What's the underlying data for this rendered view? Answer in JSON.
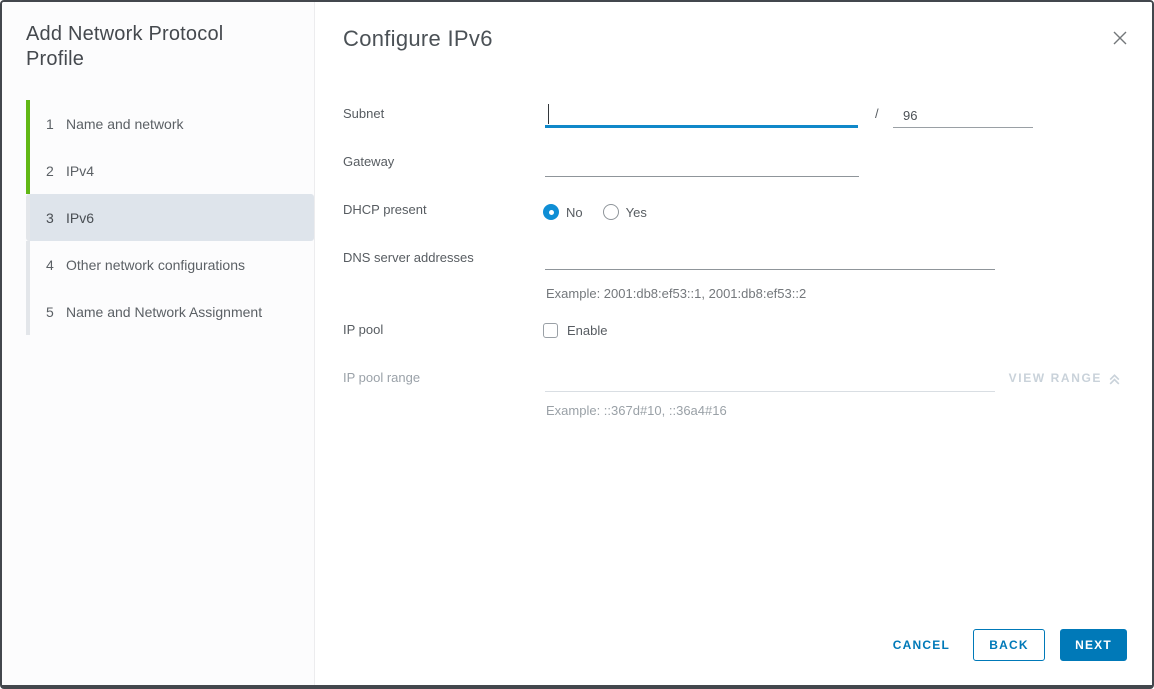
{
  "sidebar": {
    "title": "Add Network Protocol Profile",
    "steps": [
      {
        "number": "1",
        "label": "Name and network",
        "state": "completed"
      },
      {
        "number": "2",
        "label": "IPv4",
        "state": "completed"
      },
      {
        "number": "3",
        "label": "IPv6",
        "state": "active"
      },
      {
        "number": "4",
        "label": "Other network configurations",
        "state": "upcoming"
      },
      {
        "number": "5",
        "label": "Name and Network Assignment",
        "state": "upcoming"
      }
    ]
  },
  "main": {
    "title": "Configure IPv6",
    "form": {
      "subnet": {
        "label": "Subnet",
        "value": "",
        "prefix_separator": "/",
        "prefix_value": "96"
      },
      "gateway": {
        "label": "Gateway",
        "value": ""
      },
      "dhcp": {
        "label": "DHCP present",
        "options": [
          {
            "label": "No",
            "selected": true
          },
          {
            "label": "Yes",
            "selected": false
          }
        ]
      },
      "dns": {
        "label": "DNS server addresses",
        "value": "",
        "example": "Example: 2001:db8:ef53::1, 2001:db8:ef53::2"
      },
      "ip_pool": {
        "label": "IP pool",
        "checkbox_label": "Enable",
        "checked": false
      },
      "ip_pool_range": {
        "label": "IP pool range",
        "value": "",
        "example": "Example: ::367d#10, ::36a4#16",
        "view_range_label": "VIEW RANGE",
        "disabled": true
      }
    },
    "footer": {
      "cancel": "CANCEL",
      "back": "BACK",
      "next": "NEXT"
    }
  },
  "colors": {
    "accent": "#0079b8",
    "focus_underline": "#1088c9",
    "step_completed": "#61b715",
    "active_step_bg": "#dee4eb"
  }
}
